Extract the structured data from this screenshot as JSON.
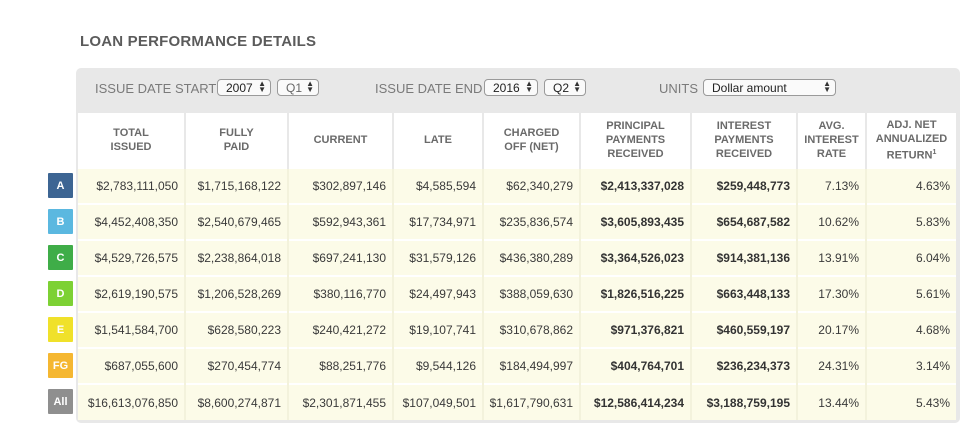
{
  "title": "LOAN PERFORMANCE DETAILS",
  "filters": {
    "issue_start_label": "ISSUE DATE START",
    "issue_start_year": "2007",
    "issue_start_quarter": "Q1",
    "issue_end_label": "ISSUE DATE END",
    "issue_end_year": "2016",
    "issue_end_quarter": "Q2",
    "units_label": "UNITS",
    "units_value": "Dollar amount"
  },
  "columns": [
    {
      "line1": "TOTAL",
      "line2": "ISSUED",
      "line3": ""
    },
    {
      "line1": "FULLY",
      "line2": "PAID",
      "line3": ""
    },
    {
      "line1": "CURRENT",
      "line2": "",
      "line3": ""
    },
    {
      "line1": "LATE",
      "line2": "",
      "line3": ""
    },
    {
      "line1": "CHARGED",
      "line2": "OFF (NET)",
      "line3": ""
    },
    {
      "line1": "PRINCIPAL",
      "line2": "PAYMENTS",
      "line3": "RECEIVED"
    },
    {
      "line1": "INTEREST",
      "line2": "PAYMENTS",
      "line3": "RECEIVED"
    },
    {
      "line1": "AVG.",
      "line2": "INTEREST",
      "line3": "RATE"
    },
    {
      "line1": "ADJ. NET",
      "line2": "ANNUALIZED",
      "line3": "RETURN",
      "sup": "1"
    }
  ],
  "rows": [
    {
      "grade": "A",
      "color": "#3d6593",
      "cells": [
        "$2,783,111,050",
        "$1,715,168,122",
        "$302,897,146",
        "$4,585,594",
        "$62,340,279",
        "$2,413,337,028",
        "$259,448,773",
        "7.13%",
        "4.63%"
      ]
    },
    {
      "grade": "B",
      "color": "#5bb8e0",
      "cells": [
        "$4,452,408,350",
        "$2,540,679,465",
        "$592,943,361",
        "$17,734,971",
        "$235,836,574",
        "$3,605,893,435",
        "$654,687,582",
        "10.62%",
        "5.83%"
      ]
    },
    {
      "grade": "C",
      "color": "#3fad48",
      "cells": [
        "$4,529,726,575",
        "$2,238,864,018",
        "$697,241,130",
        "$31,579,126",
        "$436,380,289",
        "$3,364,526,023",
        "$914,381,136",
        "13.91%",
        "6.04%"
      ]
    },
    {
      "grade": "D",
      "color": "#7dd134",
      "cells": [
        "$2,619,190,575",
        "$1,206,528,269",
        "$380,116,770",
        "$24,497,943",
        "$388,059,630",
        "$1,826,516,225",
        "$663,448,133",
        "17.30%",
        "5.61%"
      ]
    },
    {
      "grade": "E",
      "color": "#f0e12a",
      "cells": [
        "$1,541,584,700",
        "$628,580,223",
        "$240,421,272",
        "$19,107,741",
        "$310,678,862",
        "$971,376,821",
        "$460,559,197",
        "20.17%",
        "4.68%"
      ]
    },
    {
      "grade": "FG",
      "color": "#f5b731",
      "cells": [
        "$687,055,600",
        "$270,454,774",
        "$88,251,776",
        "$9,544,126",
        "$184,494,997",
        "$404,764,701",
        "$236,234,373",
        "24.31%",
        "3.14%"
      ]
    },
    {
      "grade": "All",
      "color": "#8f8f8f",
      "cells": [
        "$16,613,076,850",
        "$8,600,274,871",
        "$2,301,871,455",
        "$107,049,501",
        "$1,617,790,631",
        "$12,586,414,234",
        "$3,188,759,195",
        "13.44%",
        "5.43%"
      ]
    }
  ]
}
